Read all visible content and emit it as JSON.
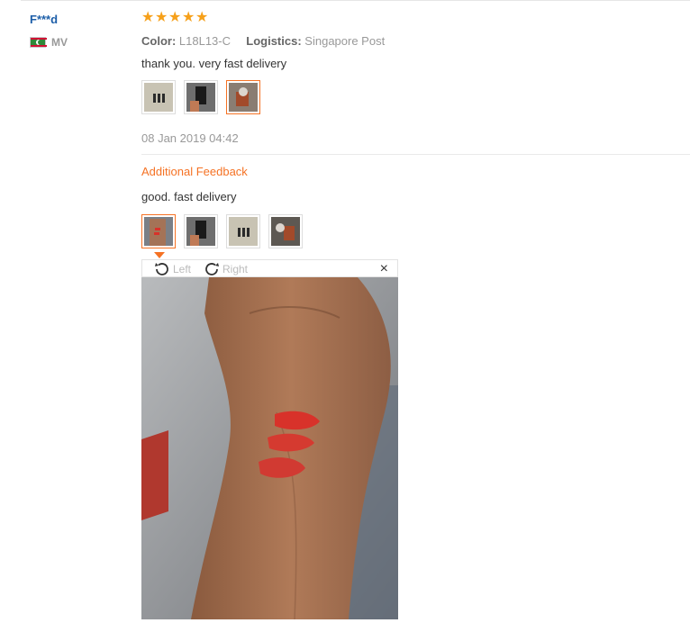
{
  "review": {
    "user_name": "F***d",
    "country_code": "MV",
    "rating": 5,
    "color_label": "Color:",
    "color_value": "L18L13-C",
    "logistics_label": "Logistics:",
    "logistics_value": "Singapore Post",
    "text": "thank you. very fast delivery",
    "date": "08 Jan 2019 04:42",
    "additional_title": "Additional Feedback",
    "additional_text": "good. fast delivery"
  },
  "viewer": {
    "rotate_left_label": "Left",
    "rotate_right_label": "Right",
    "close_symbol": "×"
  },
  "icons": [
    "star-icon",
    "flag-icon",
    "rotate-left-icon",
    "rotate-right-icon",
    "close-icon"
  ],
  "colors": {
    "accent": "#f57224",
    "star": "#f6a01a",
    "link": "#1c5ea8",
    "muted": "#999999"
  }
}
